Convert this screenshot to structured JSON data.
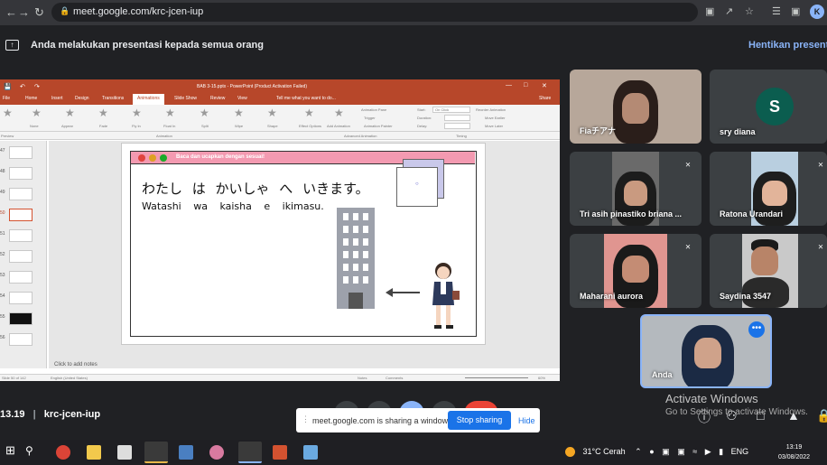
{
  "browser": {
    "url": "meet.google.com/krc-jcen-iup",
    "profile_initial": "K"
  },
  "banner": {
    "message": "Anda melakukan presentasi kepada semua orang",
    "stop_label": "Hentikan presentasi"
  },
  "ppt": {
    "title": "BAB 3-15.pptx - PowerPoint (Product Activation Failed)",
    "tabs": [
      "File",
      "Home",
      "Insert",
      "Design",
      "Transitions",
      "Animations",
      "Slide Show",
      "Review",
      "View"
    ],
    "tell_me": "Tell me what you want to do...",
    "share": "Share",
    "animations": [
      "None",
      "Appear",
      "Fade",
      "Fly In",
      "Float In",
      "Split",
      "Wipe",
      "Shape"
    ],
    "effect_options": "Effect Options",
    "add_animation": "Add Animation",
    "animation_pane": "Animation Pane",
    "trigger": "Trigger",
    "animation_painter": "Animation Painter",
    "start_label": "Start:",
    "start_value": "On Click",
    "duration_label": "Duration:",
    "delay_label": "Delay:",
    "reorder": "Reorder Animation",
    "move_earlier": "Move Earlier",
    "move_later": "Move Later",
    "group_preview": "Preview",
    "group_animation": "Animation",
    "group_advanced": "Advanced Animation",
    "group_timing": "Timing",
    "thumb_numbers": [
      "47",
      "48",
      "49",
      "50",
      "51",
      "52",
      "53",
      "54",
      "55",
      "56"
    ],
    "notes_placeholder": "Click to add notes",
    "status_slide": "Slide 50 of 142",
    "status_lang": "English (United States)",
    "status_notes": "Notes",
    "status_comments": "Comments",
    "zoom": "60%"
  },
  "slide": {
    "header": "Baca dan ucapkan dengan sesuai!",
    "japanese": "わたし は かいしゃ へ いきます。",
    "romaji": "Watashi wa kaisha e ikimasu."
  },
  "participants": [
    {
      "name": "Fiaチアナ",
      "muted": false
    },
    {
      "name": "sry diana",
      "muted": false,
      "initial": "S"
    },
    {
      "name": "Tri asih pinastiko briana ...",
      "muted": true
    },
    {
      "name": "Ratona Urandari",
      "muted": true
    },
    {
      "name": "Maharani aurora",
      "muted": true
    },
    {
      "name": "Saydina 3547",
      "muted": true
    },
    {
      "name": "Anda",
      "muted": false
    }
  ],
  "meeting": {
    "time": "13.19",
    "code": "krc-jcen-iup"
  },
  "share_bar": {
    "text": "meet.google.com is sharing a window.",
    "stop": "Stop sharing",
    "hide": "Hide"
  },
  "watermark": {
    "line1": "Activate Windows",
    "line2": "Go to Settings to activate Windows."
  },
  "taskbar": {
    "weather": "31°C  Cerah",
    "lang": "ENG",
    "time": "13:19",
    "date": "03/08/2022"
  },
  "colors": {
    "meet_bg": "#202124",
    "ppt_red": "#b7472a",
    "accent_blue": "#1a73e8",
    "slide_bar_pink": "#f39ab1"
  }
}
